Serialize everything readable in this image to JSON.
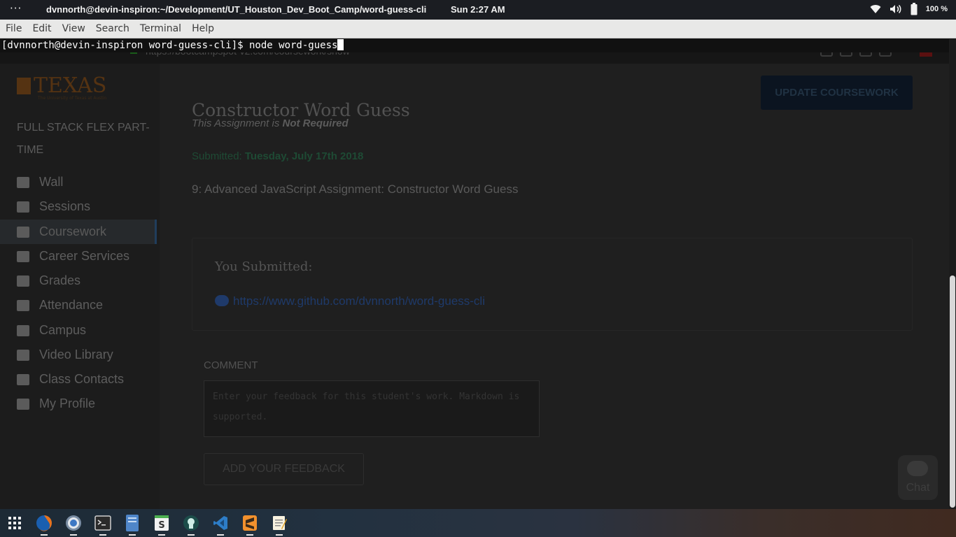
{
  "topbar": {
    "activities": "···",
    "window_title": "dvnnorth@devin-inspiron:~/Development/UT_Houston_Dev_Boot_Camp/word-guess-cli",
    "clock": "Sun  2:27 AM",
    "battery": "100 %",
    "icons": [
      "wifi-icon",
      "volume-icon",
      "battery-icon"
    ]
  },
  "menubar": {
    "items": [
      "File",
      "Edit",
      "View",
      "Search",
      "Terminal",
      "Help"
    ]
  },
  "terminal": {
    "prompt": "[dvnnorth@devin-inspiron word-guess-cli]$ node word-guess"
  },
  "page": {
    "url": "https://bootcampspot-v2.com/coursework/show",
    "logo": "TEXAS",
    "logo_sub": "The University of Texas at Austin",
    "program": "FULL STACK FLEX PART-TIME",
    "sidebar": [
      {
        "label": "Wall",
        "icon": "wall-icon"
      },
      {
        "label": "Sessions",
        "icon": "sessions-icon"
      },
      {
        "label": "Coursework",
        "icon": "coursework-icon"
      },
      {
        "label": "Career Services",
        "icon": "briefcase-icon"
      },
      {
        "label": "Grades",
        "icon": "grades-icon"
      },
      {
        "label": "Attendance",
        "icon": "calendar-icon"
      },
      {
        "label": "Campus",
        "icon": "map-pin-icon"
      },
      {
        "label": "Video Library",
        "icon": "film-icon"
      },
      {
        "label": "Class Contacts",
        "icon": "user-icon"
      },
      {
        "label": "My Profile",
        "icon": "users-icon"
      }
    ],
    "title": "Constructor Word Guess",
    "update_button": "UPDATE COURSEWORK",
    "required_prefix": "This Assignment is ",
    "required_value": "Not Required",
    "submitted_prefix": "Submitted: ",
    "submitted_date": "Tuesday, July 17th 2018",
    "assignment": "9: Advanced JavaScript Assignment: Constructor Word Guess",
    "you_submitted": "You Submitted:",
    "github_link": "https://www.github.com/dvnnorth/word-guess-cli",
    "comment_label": "COMMENT",
    "comment_placeholder": "Enter your feedback for this student's work. Markdown is supported.",
    "feedback_button": "ADD YOUR FEEDBACK",
    "chat": "Chat"
  },
  "taskbar": {
    "apps": [
      {
        "name": "app-launcher-icon",
        "running": false
      },
      {
        "name": "firefox-icon",
        "running": true
      },
      {
        "name": "chrome-icon",
        "running": true
      },
      {
        "name": "terminal-icon",
        "running": true
      },
      {
        "name": "files-icon",
        "running": true
      },
      {
        "name": "slack-icon",
        "running": true
      },
      {
        "name": "gitkraken-icon",
        "running": true
      },
      {
        "name": "vscode-icon",
        "running": true
      },
      {
        "name": "sublime-icon",
        "running": true
      },
      {
        "name": "text-editor-icon",
        "running": true
      }
    ]
  }
}
